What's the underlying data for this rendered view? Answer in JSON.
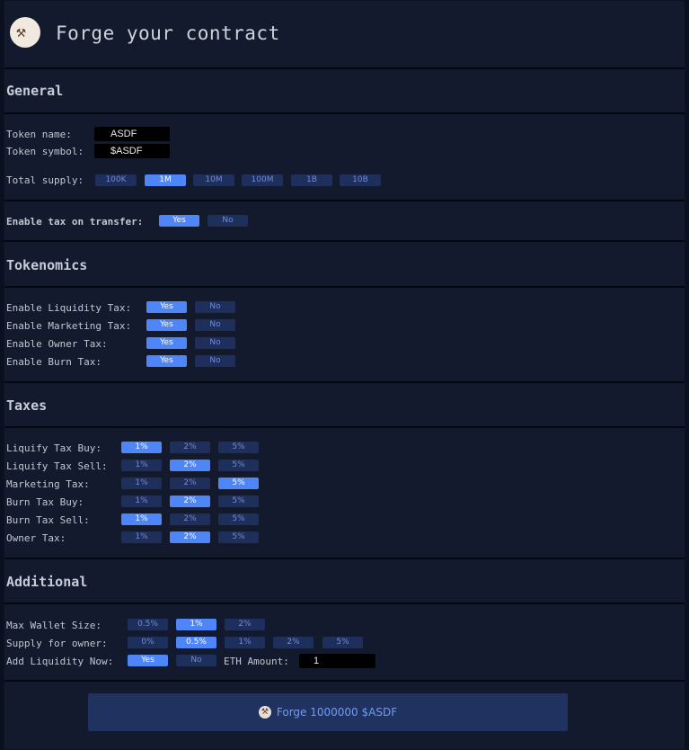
{
  "header": {
    "title": "Forge your contract",
    "logo_icon": "anvil-hammer-logo"
  },
  "general": {
    "title": "General",
    "token_name_label": "Token name:",
    "token_name_value": "ASDF",
    "token_symbol_label": "Token symbol:",
    "token_symbol_value": "$ASDF",
    "total_supply_label": "Total supply:",
    "supply_options": [
      "100K",
      "1M",
      "10M",
      "100M",
      "1B",
      "10B"
    ],
    "supply_selected": "1M",
    "tax_label": "Enable tax on transfer:",
    "tax_yes": "Yes",
    "tax_no": "No",
    "tax_selected": "Yes"
  },
  "tokenomics": {
    "title": "Tokenomics",
    "rows": [
      {
        "label": "Enable Liquidity Tax:",
        "yes": "Yes",
        "no": "No",
        "selected": "Yes"
      },
      {
        "label": "Enable Marketing Tax:",
        "yes": "Yes",
        "no": "No",
        "selected": "Yes"
      },
      {
        "label": "Enable Owner Tax:",
        "yes": "Yes",
        "no": "No",
        "selected": "Yes"
      },
      {
        "label": "Enable Burn Tax:",
        "yes": "Yes",
        "no": "No",
        "selected": "Yes"
      }
    ]
  },
  "taxes": {
    "title": "Taxes",
    "options": [
      "1%",
      "2%",
      "5%"
    ],
    "rows": [
      {
        "label": "Liquify Tax Buy:",
        "selected": "1%"
      },
      {
        "label": "Liquify Tax Sell:",
        "selected": "2%"
      },
      {
        "label": "Marketing Tax:",
        "selected": "5%"
      },
      {
        "label": "Burn Tax Buy:",
        "selected": "2%"
      },
      {
        "label": "Burn Tax Sell:",
        "selected": "1%"
      },
      {
        "label": "Owner Tax:",
        "selected": "2%"
      }
    ]
  },
  "additional": {
    "title": "Additional",
    "max_wallet_label": "Max Wallet Size:",
    "max_wallet_options": [
      "0.5%",
      "1%",
      "2%"
    ],
    "max_wallet_selected": "1%",
    "supply_owner_label": "Supply for owner:",
    "supply_owner_options": [
      "0%",
      "0.5%",
      "1%",
      "2%",
      "5%"
    ],
    "supply_owner_selected": "0.5%",
    "add_liquidity_label": "Add Liquidity Now:",
    "add_liquidity_yes": "Yes",
    "add_liquidity_no": "No",
    "add_liquidity_selected": "Yes",
    "eth_amount_label": "ETH Amount:",
    "eth_amount_value": "1"
  },
  "forge_button": {
    "label": "Forge 1000000 $ASDF",
    "icon": "anvil-hammer-icon"
  },
  "colors": {
    "selected": "#4f86f7",
    "unselected": "#1f2f5c",
    "panel": "#131a2e"
  }
}
